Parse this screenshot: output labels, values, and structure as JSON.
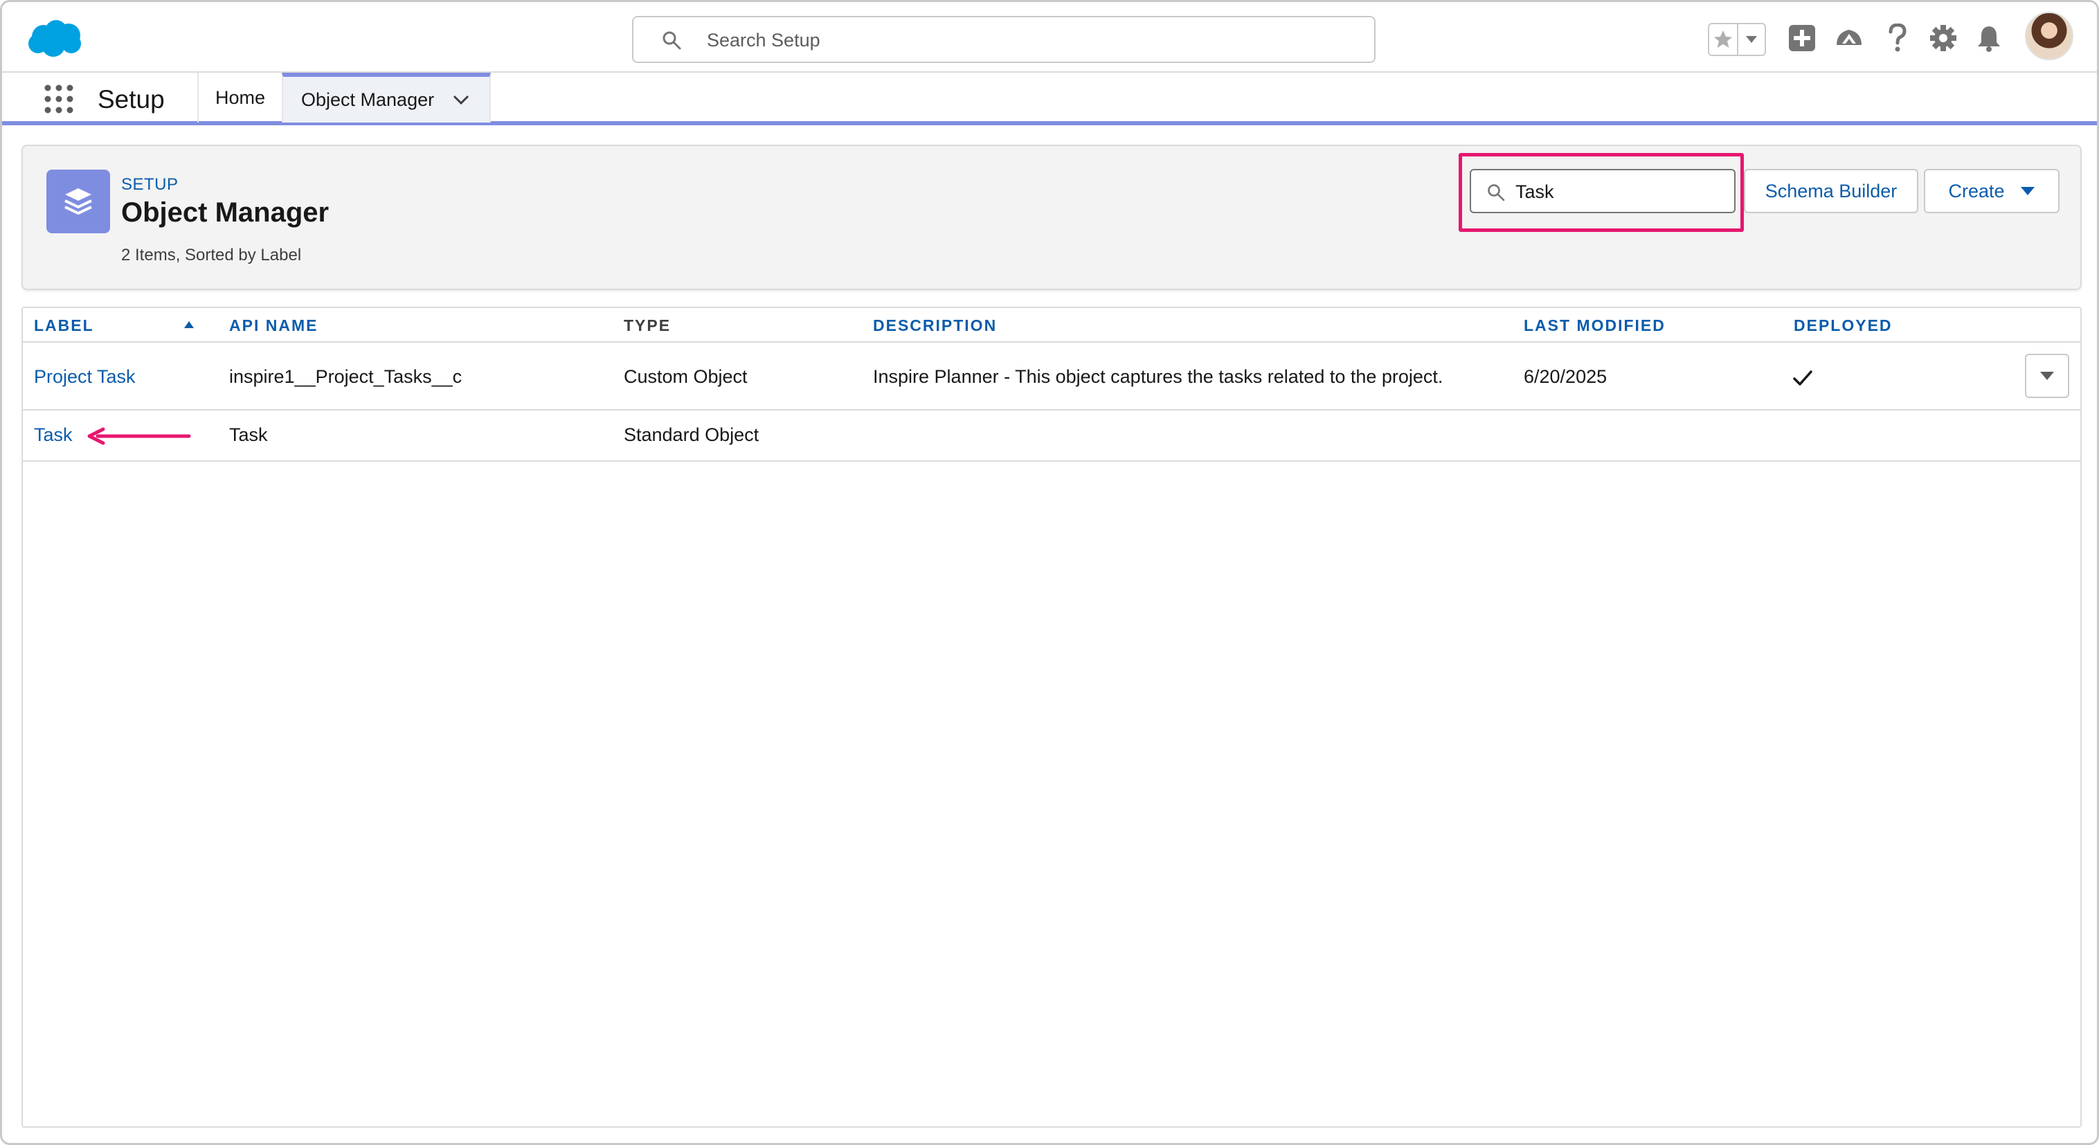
{
  "global_header": {
    "search_placeholder": "Search Setup",
    "icons": [
      "salesforce-logo",
      "star-icon",
      "chevron-down-icon",
      "plus-icon",
      "trailhead-icon",
      "help-icon",
      "gear-icon",
      "bell-icon",
      "avatar"
    ]
  },
  "nav": {
    "app_name": "Setup",
    "tabs": [
      {
        "label": "Home"
      },
      {
        "label": "Object Manager"
      }
    ]
  },
  "page_header": {
    "breadcrumb": "SETUP",
    "title": "Object Manager",
    "item_count": "2 Items, Sorted by Label",
    "quick_find_value": "Task",
    "schema_builder_label": "Schema Builder",
    "create_label": "Create"
  },
  "table": {
    "columns": [
      "LABEL",
      "API NAME",
      "TYPE",
      "DESCRIPTION",
      "LAST MODIFIED",
      "DEPLOYED"
    ],
    "rows": [
      {
        "label": "Project Task",
        "api_name": "inspire1__Project_Tasks__c",
        "type": "Custom Object",
        "description": "Inspire Planner - This object captures the tasks related to the project.",
        "last_modified": "6/20/2025",
        "deployed": true
      },
      {
        "label": "Task",
        "api_name": "Task",
        "type": "Standard Object",
        "description": "",
        "last_modified": "",
        "deployed": false
      }
    ]
  },
  "colors": {
    "brand_blue": "#0b5cab",
    "accent_purple": "#7f8de1",
    "highlight_pink": "#e6176f",
    "cloud_blue": "#00a1e0"
  }
}
